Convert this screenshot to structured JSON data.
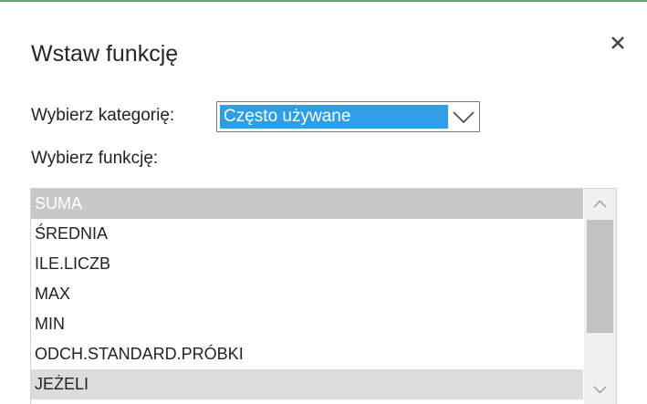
{
  "dialog": {
    "title": "Wstaw funkcję",
    "close_icon": "close-icon"
  },
  "category": {
    "label": "Wybierz kategorię:",
    "selected_value": "Często używane",
    "chevron_icon": "chevron-down-icon"
  },
  "functions": {
    "label": "Wybierz funkcję:",
    "items": [
      {
        "label": "SUMA",
        "state": "selected"
      },
      {
        "label": "ŚREDNIA",
        "state": "normal"
      },
      {
        "label": "ILE.LICZB",
        "state": "normal"
      },
      {
        "label": "MAX",
        "state": "normal"
      },
      {
        "label": "MIN",
        "state": "normal"
      },
      {
        "label": "ODCH.STANDARD.PRÓBKI",
        "state": "normal"
      },
      {
        "label": "JEŻELI",
        "state": "hover"
      }
    ]
  },
  "colors": {
    "accent": "#2e9ee6",
    "selected_row": "#c8c8c8",
    "hover_row": "#dcdcdc",
    "top_border": "#6aa56f"
  }
}
